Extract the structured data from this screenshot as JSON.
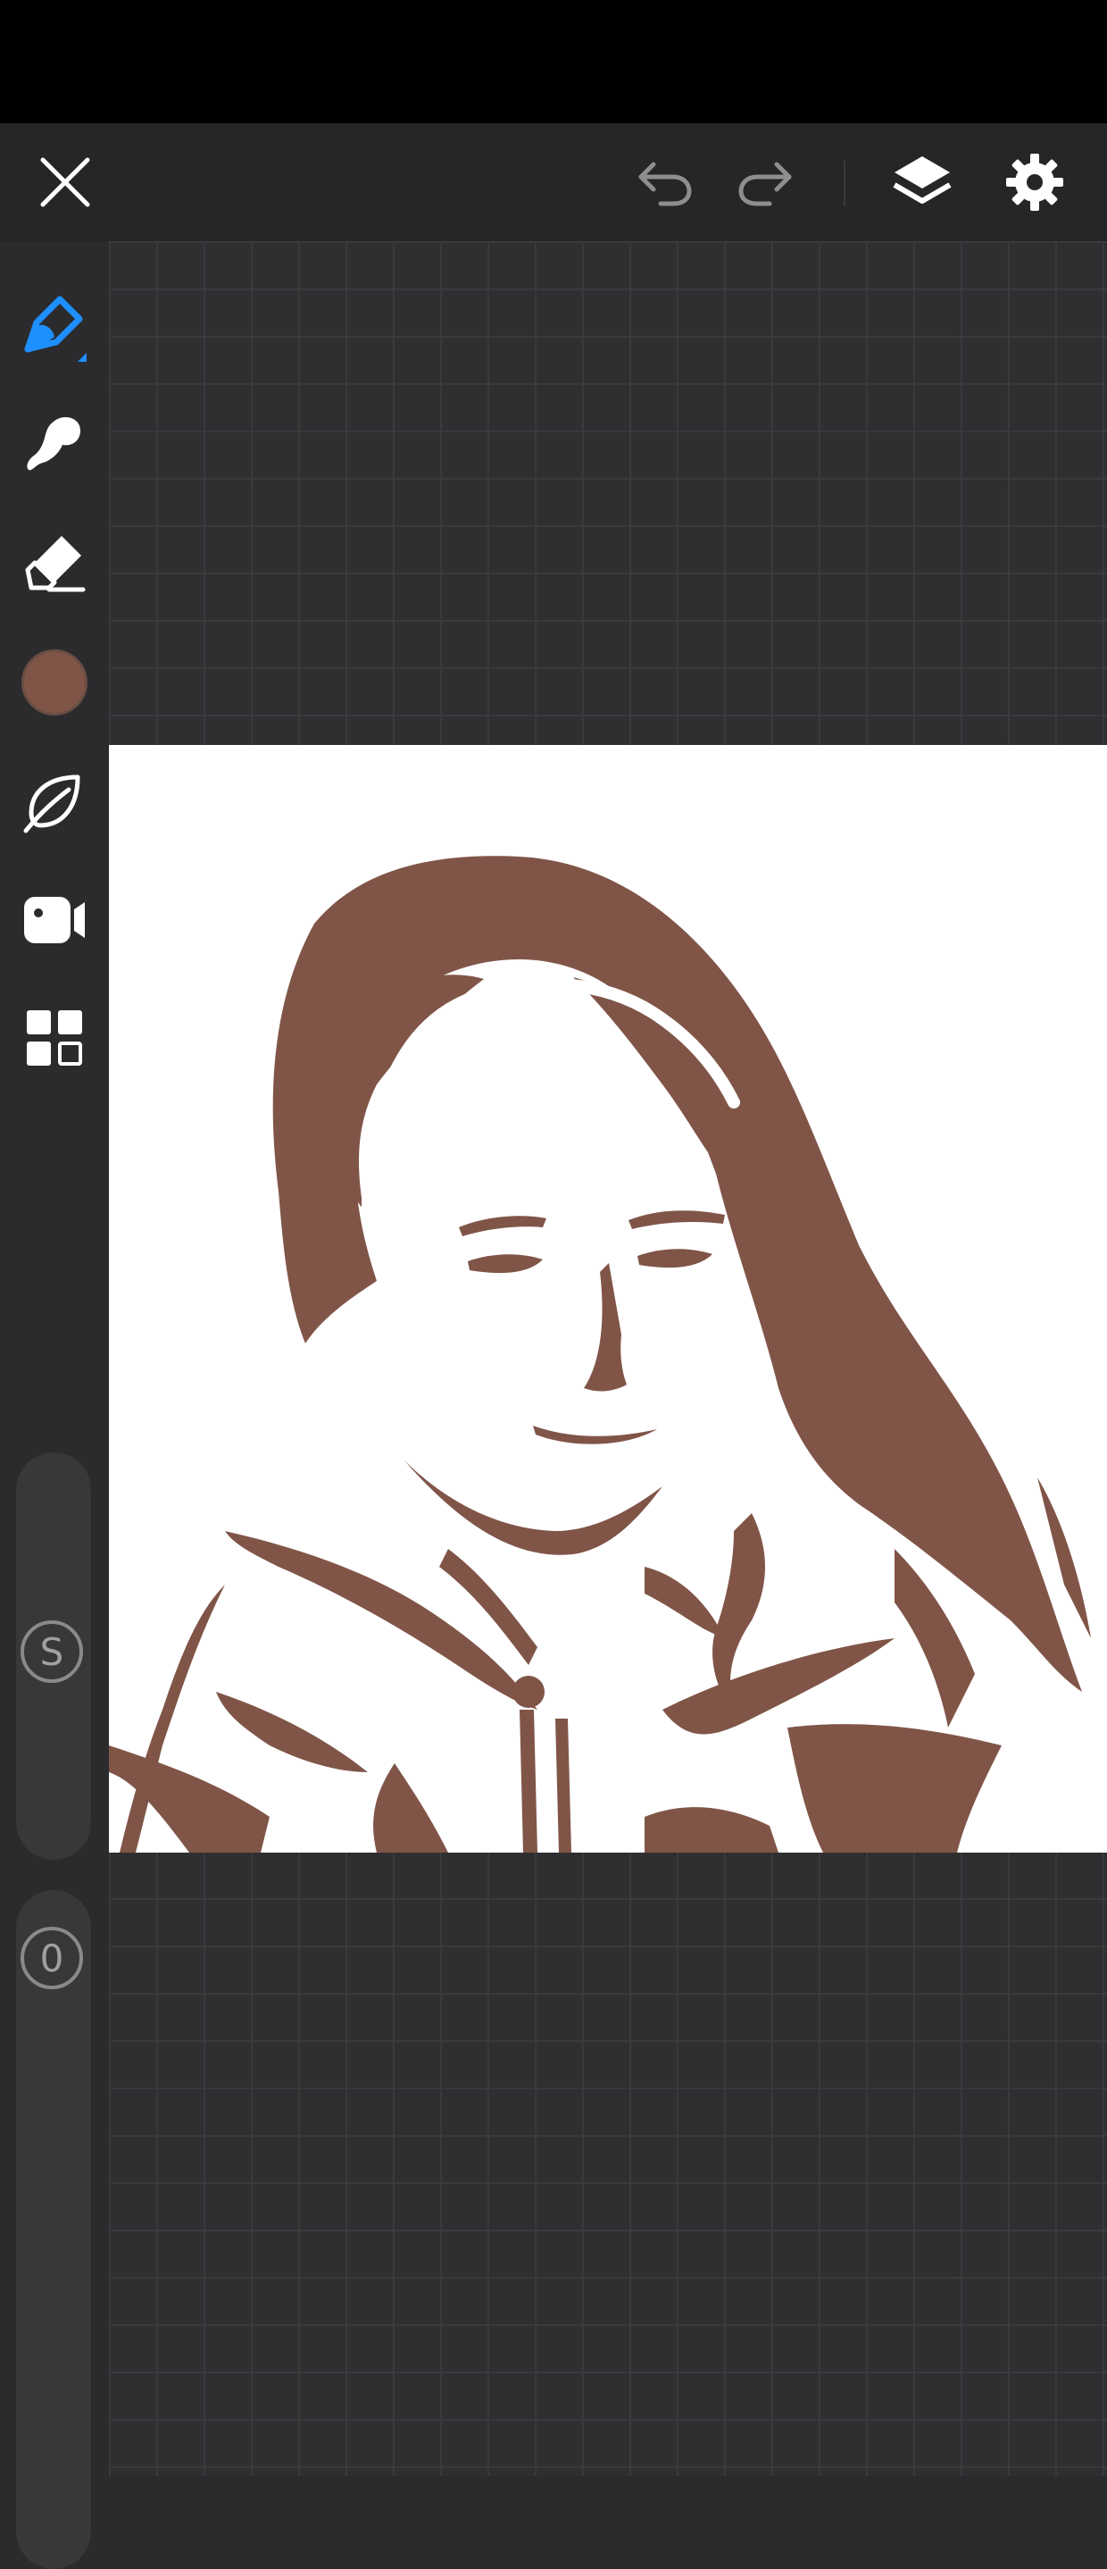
{
  "colors": {
    "active_tool": "#1e8fff",
    "brush_color": "#805548",
    "icon": "#ffffff",
    "icon_dim": "#8e8e90"
  },
  "toolbar": {
    "close_icon": "close-icon",
    "undo_icon": "undo-icon",
    "redo_icon": "redo-icon",
    "layers_icon": "layers-icon",
    "settings_icon": "gear-icon"
  },
  "tools": [
    "pencil-icon",
    "smudge-icon",
    "eraser-icon",
    "color-swatch",
    "leaf-icon",
    "video-camera-icon",
    "grid-icon"
  ],
  "sliders": {
    "size_label": "S",
    "opacity_label": "0"
  }
}
